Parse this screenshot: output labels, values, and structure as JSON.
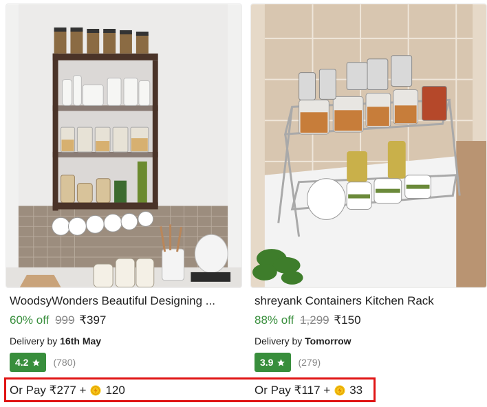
{
  "products": [
    {
      "title": "WoodsyWonders Beautiful Designing ...",
      "discount": "60% off",
      "mrp": "999",
      "price": "₹397",
      "delivery_prefix": "Delivery by",
      "delivery_date": "16th May",
      "rating": "4.2",
      "rating_count": "(780)",
      "pay_text": "Or Pay ₹277 +",
      "coins": "120",
      "image_icon": "wall-spice-rack-image"
    },
    {
      "title": "shreyank Containers Kitchen Rack",
      "discount": "88% off",
      "mrp": "1,299",
      "price": "₹150",
      "delivery_prefix": "Delivery by",
      "delivery_date": "Tomorrow",
      "rating": "3.9",
      "rating_count": "(279)",
      "pay_text": "Or Pay ₹117 +",
      "coins": "33",
      "image_icon": "counter-spice-rack-image"
    }
  ],
  "colors": {
    "discount_green": "#388e3c",
    "rating_green": "#388e3c",
    "highlight_red": "#e01414",
    "coin_yellow": "#f5c518"
  }
}
